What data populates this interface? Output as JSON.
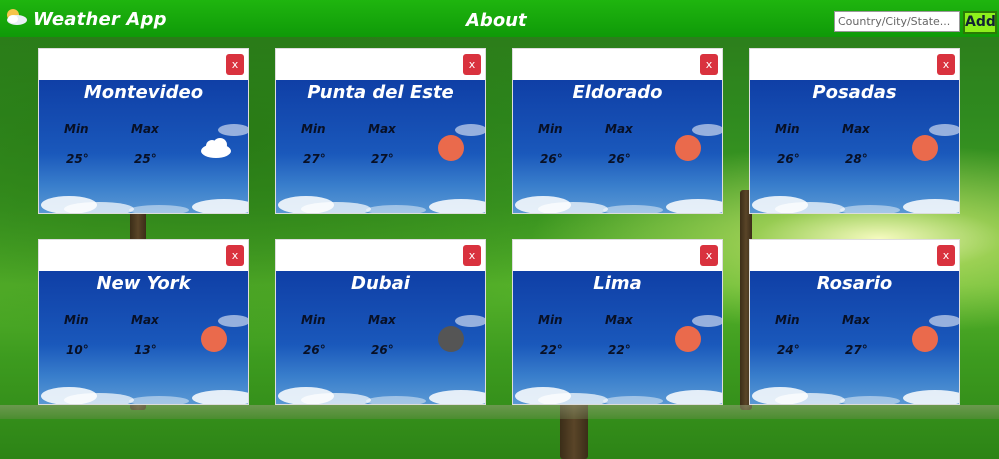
{
  "app": {
    "brand": "Weather App",
    "about_label": "About"
  },
  "search": {
    "placeholder": "Country/City/State...",
    "value": "",
    "add_label": "Add"
  },
  "cards": [
    {
      "city": "Montevideo",
      "min_label": "Min",
      "max_label": "Max",
      "min": "25°",
      "max": "25°",
      "icon": "cloud-icon",
      "close_label": "x"
    },
    {
      "city": "Punta del Este",
      "min_label": "Min",
      "max_label": "Max",
      "min": "27°",
      "max": "27°",
      "icon": "sun-icon",
      "close_label": "x"
    },
    {
      "city": "Eldorado",
      "min_label": "Min",
      "max_label": "Max",
      "min": "26°",
      "max": "26°",
      "icon": "sun-icon",
      "close_label": "x"
    },
    {
      "city": "Posadas",
      "min_label": "Min",
      "max_label": "Max",
      "min": "26°",
      "max": "28°",
      "icon": "sun-icon",
      "close_label": "x"
    },
    {
      "city": "New York",
      "min_label": "Min",
      "max_label": "Max",
      "min": "10°",
      "max": "13°",
      "icon": "sun-icon",
      "close_label": "x"
    },
    {
      "city": "Dubai",
      "min_label": "Min",
      "max_label": "Max",
      "min": "26°",
      "max": "26°",
      "icon": "moon-icon",
      "close_label": "x"
    },
    {
      "city": "Lima",
      "min_label": "Min",
      "max_label": "Max",
      "min": "22°",
      "max": "22°",
      "icon": "sun-icon",
      "close_label": "x"
    },
    {
      "city": "Rosario",
      "min_label": "Min",
      "max_label": "Max",
      "min": "24°",
      "max": "27°",
      "icon": "sun-icon",
      "close_label": "x"
    }
  ],
  "colors": {
    "navbar": "#1fb50f",
    "add_button": "#8df01c",
    "close_button": "#d9323e",
    "sun": "#ea6a4c",
    "moon": "#555555"
  }
}
